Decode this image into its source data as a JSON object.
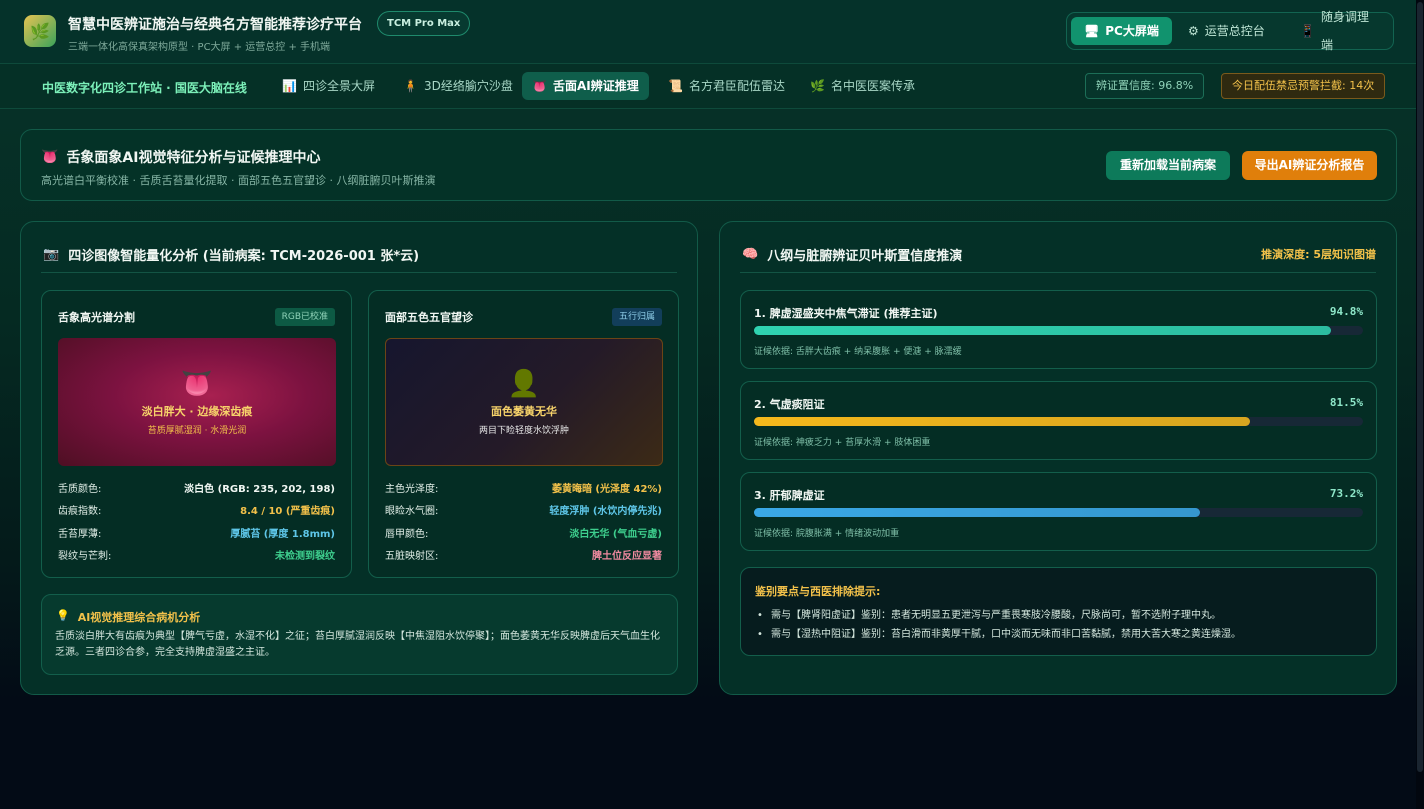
{
  "header": {
    "logo_glyph": "🌿",
    "title": "智慧中医辨证施治与经典名方智能推荐诊疗平台",
    "badge": "TCM Pro Max",
    "subtitle": "三端一体化高保真架构原型 · PC大屏 + 运营总控 + 手机端",
    "modes": [
      {
        "icon": "🖥",
        "label": "PC大屏端",
        "active": true
      },
      {
        "icon": "⚙",
        "label": "运营总控台",
        "active": false
      },
      {
        "icon": "📱",
        "label": "随身调理端",
        "active": false
      }
    ]
  },
  "nav": {
    "brand": "中医数字化四诊工作站 · 国医大脑在线",
    "items": [
      {
        "icon": "📊",
        "label": "四诊全景大屏",
        "active": false
      },
      {
        "icon": "🧍",
        "label": "3D经络腧穴沙盘",
        "active": false
      },
      {
        "icon": "👅",
        "label": "舌面AI辨证推理",
        "active": true
      },
      {
        "icon": "📜",
        "label": "名方君臣配伍雷达",
        "active": false
      },
      {
        "icon": "🌿",
        "label": "名中医医案传承",
        "active": false
      }
    ],
    "confidence": "辨证置信度: 96.8%",
    "warning": "今日配伍禁忌预警拦截: 14次"
  },
  "hero": {
    "icon": "👅",
    "title": "舌象面象AI视觉特征分析与证候推理中心",
    "subtitle": "高光谱白平衡校准 · 舌质舌苔量化提取 · 面部五色五官望诊 · 八纲脏腑贝叶斯推演",
    "reload_label": "重新加载当前病案",
    "export_label": "导出AI辨证分析报告"
  },
  "left_panel": {
    "icon": "📷",
    "title": "四诊图像智能量化分析 (当前病案: TCM-2026-001 张*云)",
    "tongue": {
      "title": "舌象高光谱分割",
      "badge": "RGB已校准",
      "image_icon": "👅",
      "image_caption": "淡白胖大 · 边缘深齿痕",
      "image_sub": "苔质厚腻湿润 · 水滑光润",
      "rows": [
        {
          "k": "舌质颜色:",
          "v": "淡白色 (RGB: 235, 202, 198)",
          "color": "#f1f7f3"
        },
        {
          "k": "齿痕指数:",
          "v": "8.4 / 10 (严重齿痕)",
          "color": "#f2c14a"
        },
        {
          "k": "舌苔厚薄:",
          "v": "厚腻苔 (厚度 1.8mm)",
          "color": "#5ec6e8"
        },
        {
          "k": "裂纹与芒刺:",
          "v": "未检测到裂纹",
          "color": "#3ecf8e"
        }
      ]
    },
    "face": {
      "title": "面部五色五官望诊",
      "badge": "五行归属",
      "image_icon": "👤",
      "image_caption": "面色萎黄无华",
      "image_sub": "两目下睑轻度水饮浮肿",
      "rows": [
        {
          "k": "主色光泽度:",
          "v": "萎黄晦暗 (光泽度 42%)",
          "color": "#f2c14a"
        },
        {
          "k": "眼睑水气圈:",
          "v": "轻度浮肿 (水饮内停先兆)",
          "color": "#5ec6e8"
        },
        {
          "k": "唇甲颜色:",
          "v": "淡白无华 (气血亏虚)",
          "color": "#3ecf8e"
        },
        {
          "k": "五脏映射区:",
          "v": "脾土位反应显著",
          "color": "#f08aa0"
        }
      ]
    },
    "insight": {
      "icon": "💡",
      "title": "AI视觉推理综合病机分析",
      "body": "舌质淡白胖大有齿痕为典型【脾气亏虚，水湿不化】之征；苔白厚腻湿润反映【中焦湿阻水饮停聚】；面色萎黄无华反映脾虚后天气血生化乏源。三者四诊合参，完全支持脾虚湿盛之主证。"
    }
  },
  "right_panel": {
    "icon": "🧠",
    "title": "八纲与脏腑辨证贝叶斯置信度推演",
    "depth": "推演深度: 5层知识图谱",
    "syndromes": [
      {
        "name": "1. 脾虚湿盛夹中焦气滞证 (推荐主证)",
        "pct_label": "94.8%",
        "value": 0.948,
        "color": "#2fd3b0",
        "basis": "证候依据: 舌胖大齿痕 + 纳呆腹胀 + 便溏 + 脉濡缓"
      },
      {
        "name": "2. 气虚痰阻证",
        "pct_label": "81.5%",
        "value": 0.815,
        "color": "#f5b81c",
        "basis": "证候依据: 神疲乏力 + 苔厚水滑 + 肢体困重"
      },
      {
        "name": "3. 肝郁脾虚证",
        "pct_label": "73.2%",
        "value": 0.732,
        "color": "#3aa8e6",
        "basis": "证候依据: 脘腹胀满 + 情绪波动加重"
      }
    ],
    "differential": {
      "title": "鉴别要点与西医排除提示:",
      "items": [
        "需与【脾肾阳虚证】鉴别：患者无明显五更泄泻与严重畏寒肢冷腰酸，尺脉尚可，暂不选附子理中丸。",
        "需与【湿热中阻证】鉴别：苔白滑而非黄厚干腻，口中淡而无味而非口苦黏腻，禁用大苦大寒之黄连燥湿。"
      ]
    }
  }
}
